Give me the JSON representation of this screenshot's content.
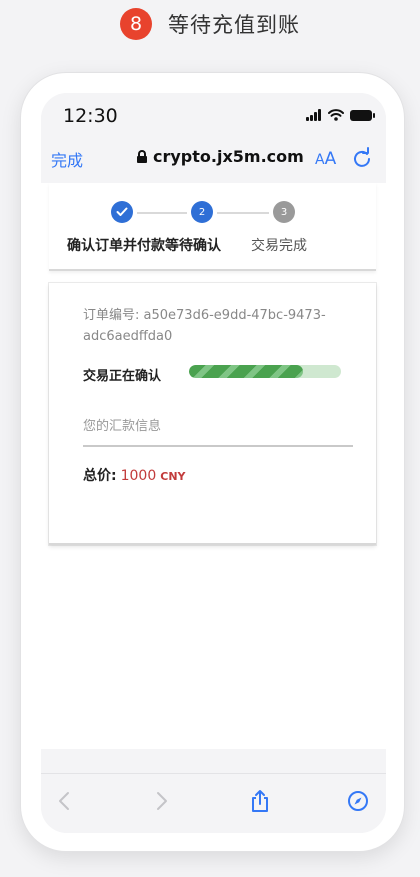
{
  "header": {
    "step_number": "8",
    "title": "等待充值到账"
  },
  "statusbar": {
    "time": "12:30"
  },
  "browser": {
    "done_label": "完成",
    "url": "crypto.jx5m.com",
    "text_size_label_small": "A",
    "text_size_label_big": "A"
  },
  "steps": {
    "step1_label": "确认订单并付款",
    "step2_number": "2",
    "step2_label": "等待确认",
    "step3_number": "3",
    "step3_label": "交易完成"
  },
  "order": {
    "order_id_label": "订单编号:",
    "order_id": "a50e73d6-e9dd-47bc-9473-adc6aedffda0",
    "transaction_label": "交易正在确认",
    "progress_percent": 75,
    "remit_info_label": "您的汇款信息",
    "total_label": "总价:",
    "total_value": "1000",
    "total_unit": "CNY"
  },
  "colors": {
    "accent_blue": "#3478f6",
    "step_active": "#2f6fd6",
    "step_inactive": "#9a9a9a",
    "progress_green": "#4aa24f",
    "price_red": "#c23b3b",
    "badge_red": "#e8432d"
  }
}
